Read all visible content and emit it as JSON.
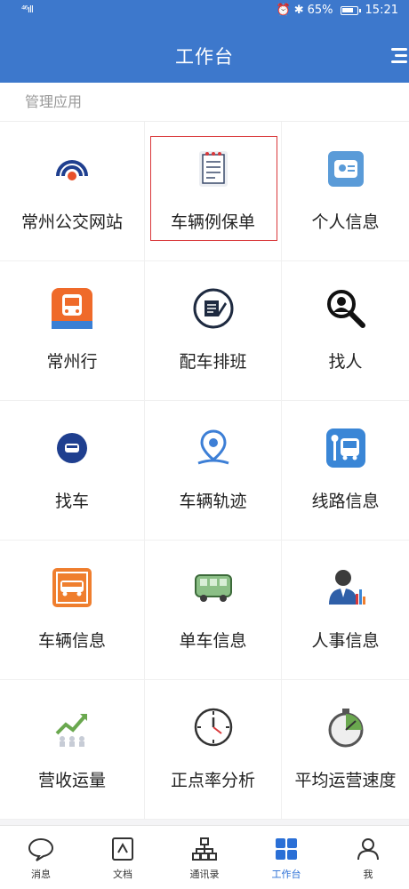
{
  "status_bar": {
    "signal": "⁴⁶ıll",
    "battery_percent": "65%",
    "time": "15:21"
  },
  "header": {
    "title": "工作台"
  },
  "section": {
    "title": "管理应用"
  },
  "apps": [
    {
      "label": "常州公交网站",
      "icon": "radio-waves-icon",
      "selected": false
    },
    {
      "label": "车辆例保单",
      "icon": "notepad-icon",
      "selected": true
    },
    {
      "label": "个人信息",
      "icon": "id-card-icon",
      "selected": false
    },
    {
      "label": "常州行",
      "icon": "bus-app-icon",
      "selected": false
    },
    {
      "label": "配车排班",
      "icon": "schedule-pen-icon",
      "selected": false
    },
    {
      "label": "找人",
      "icon": "person-search-icon",
      "selected": false
    },
    {
      "label": "找车",
      "icon": "car-locate-icon",
      "selected": false
    },
    {
      "label": "车辆轨迹",
      "icon": "location-pin-icon",
      "selected": false
    },
    {
      "label": "线路信息",
      "icon": "bus-stop-icon",
      "selected": false
    },
    {
      "label": "车辆信息",
      "icon": "bus-sign-icon",
      "selected": false
    },
    {
      "label": "单车信息",
      "icon": "van-icon",
      "selected": false
    },
    {
      "label": "人事信息",
      "icon": "business-person-icon",
      "selected": false
    },
    {
      "label": "营收运量",
      "icon": "growth-chart-icon",
      "selected": false
    },
    {
      "label": "正点率分析",
      "icon": "clock-icon",
      "selected": false
    },
    {
      "label": "平均运营速度",
      "icon": "stopwatch-icon",
      "selected": false
    }
  ],
  "tabs": [
    {
      "label": "消息",
      "icon": "chat-bubble-icon",
      "active": false
    },
    {
      "label": "文档",
      "icon": "document-icon",
      "active": false
    },
    {
      "label": "通讯录",
      "icon": "org-chart-icon",
      "active": false
    },
    {
      "label": "工作台",
      "icon": "grid-icon",
      "active": true
    },
    {
      "label": "我",
      "icon": "person-icon",
      "active": false
    }
  ],
  "colors": {
    "header": "#3d78cc",
    "accent": "#2a6fd6",
    "selection": "#d9383a"
  }
}
